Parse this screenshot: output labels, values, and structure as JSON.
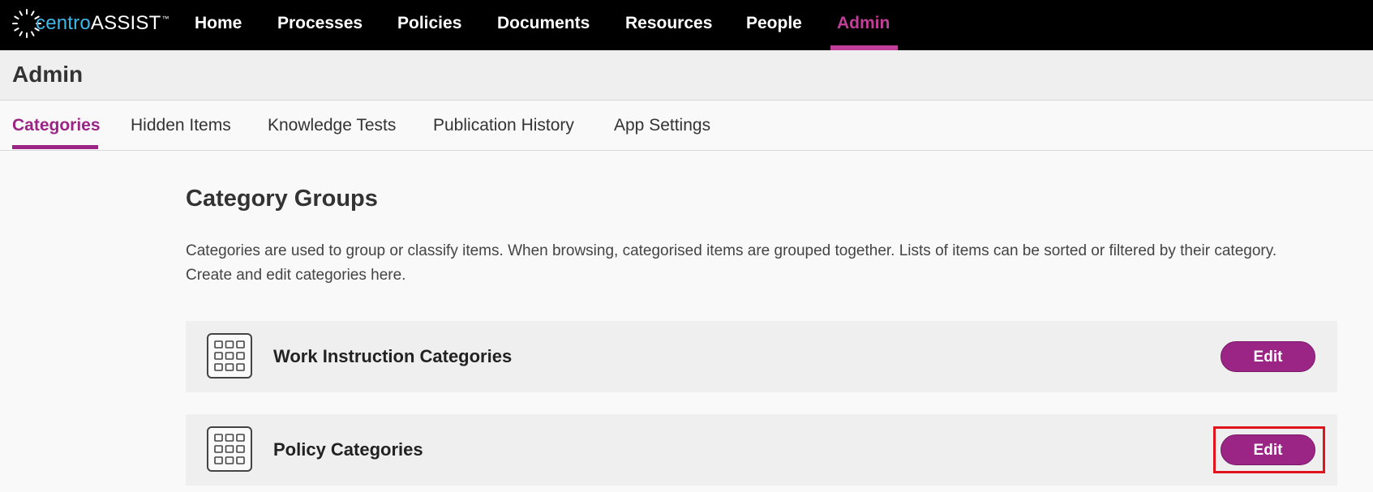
{
  "app": {
    "logo": {
      "brand_part1": "centro",
      "brand_part2": "ASSIST",
      "trademark": "™"
    },
    "nav": [
      {
        "label": "Home",
        "active": false
      },
      {
        "label": "Processes",
        "active": false
      },
      {
        "label": "Policies",
        "active": false
      },
      {
        "label": "Documents",
        "active": false
      },
      {
        "label": "Resources",
        "active": false
      },
      {
        "label": "People",
        "active": false
      },
      {
        "label": "Admin",
        "active": true
      }
    ]
  },
  "page": {
    "title": "Admin"
  },
  "tabs": [
    {
      "label": "Categories",
      "active": true
    },
    {
      "label": "Hidden Items",
      "active": false
    },
    {
      "label": "Knowledge Tests",
      "active": false
    },
    {
      "label": "Publication History",
      "active": false
    },
    {
      "label": "App Settings",
      "active": false
    }
  ],
  "main": {
    "title": "Category Groups",
    "description": "Categories are used to group or classify items. When browsing, categorised items are grouped together. Lists of items can be sorted or filtered by their category. Create and edit categories here.",
    "groups": [
      {
        "name": "Work Instruction Categories",
        "icon": "grid-icon",
        "button_label": "Edit"
      },
      {
        "name": "Policy Categories",
        "icon": "grid-icon",
        "button_label": "Edit",
        "highlighted": true
      }
    ]
  },
  "colors": {
    "accent": "#9b2585",
    "nav_active": "#c13f98",
    "topbar_bg": "#000000",
    "logo_blue": "#3fb8e8",
    "highlight": "#e0141c"
  }
}
